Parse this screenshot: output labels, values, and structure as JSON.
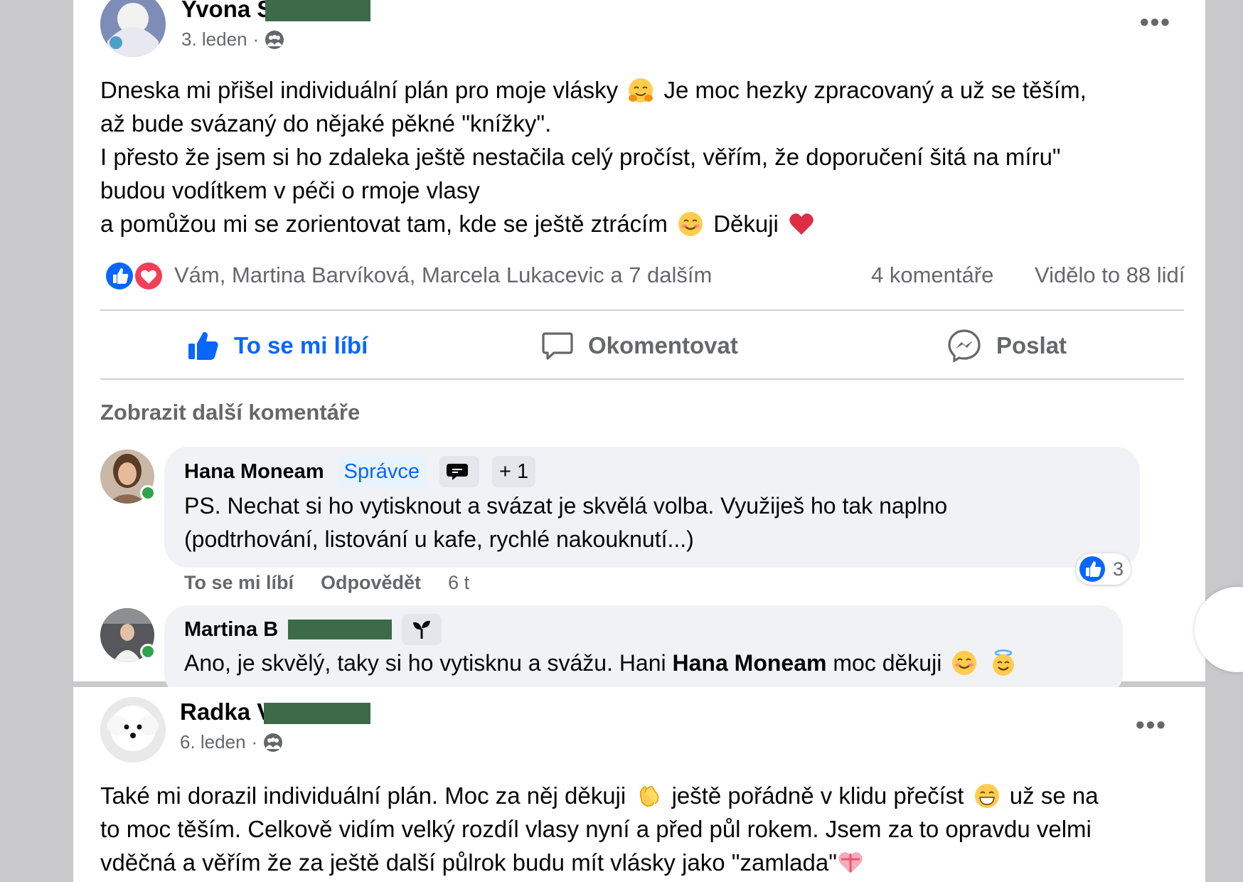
{
  "post1": {
    "author_first": "Yvona",
    "author_last_initial": "S",
    "date": "3. leden",
    "date_sep": "·",
    "audience_icon": "group-audience-icon",
    "text_lines": [
      "Dneska mi přišel individuální plán pro moje vlásky",
      "Je moc hezky zpracovaný a už se těším,",
      "až bude svázaný do nějaké pěkné \"knížky\".",
      "I přesto že jsem si ho zdaleka ještě nestačila celý pročíst, věřím, že doporučení šitá na míru\"",
      "budou vodítkem v péči o rmoje vlasy",
      "a pomůžou mi se zorientovat tam, kde se ještě ztrácím",
      "Děkuji"
    ],
    "reactions_text": "Vám, Martina Barvíková, Marcela Lukacevic a 7 dalším",
    "comments_count": "4 komentáře",
    "views_count": "Vidělo to 88 lidí",
    "more_menu": "•••"
  },
  "actions": {
    "like": "To se mi líbí",
    "comment": "Okomentovat",
    "share": "Poslat"
  },
  "more_comments": "Zobrazit další komentáře",
  "comment1": {
    "author": "Hana Moneam",
    "role_badge": "Správce",
    "extra_badge": "+ 1",
    "text_line1": "PS. Nechat si ho vytisknout a svázat je skvělá volba. Využiješ ho tak naplno",
    "text_line2": "(podtrhování, listování u kafe, rychlé nakouknutí...)",
    "like_action": "To se mi líbí",
    "reply_action": "Odpovědět",
    "time": "6 t",
    "like_count": "3"
  },
  "comment2": {
    "author_first": "Martina",
    "author_initial": "B",
    "text_before": "Ano, je skvělý, taky si ho vytisknu a svážu. Hani",
    "mention": "Hana Moneam",
    "text_after": "moc děkuji"
  },
  "post2": {
    "author_first": "Radka",
    "author_last_initial": "V",
    "date": "6. leden",
    "date_sep": "·",
    "more_menu": "•••",
    "text_line1_a": "Také mi dorazil individuální plán. Moc za něj děkuji",
    "text_line1_b": "ještě pořádně v klidu přečíst",
    "text_line1_c": "už se na",
    "text_line2": "to moc těším. Celkově vidím velký rozdíl vlasy nyní a před půl rokem. Jsem za to opravdu velmi",
    "text_line3": "vděčná a věřím že za ještě další půlrok budu mít vlásky jako \"zamlada\""
  },
  "colors": {
    "accent": "#0866ff",
    "muted": "#65676b",
    "bubble": "#f0f2f5",
    "online": "#31a24c",
    "redaction": "#3d6b4a",
    "heart": "#f33e58"
  }
}
